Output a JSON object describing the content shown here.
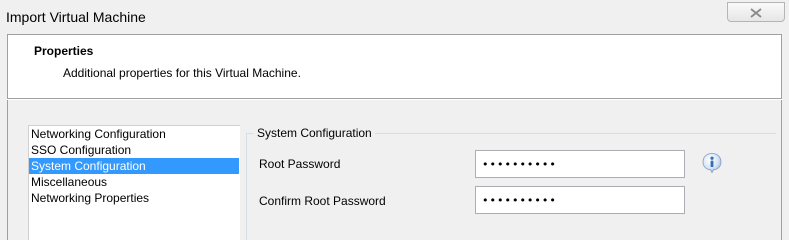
{
  "window": {
    "title": "Import Virtual Machine"
  },
  "header": {
    "title": "Properties",
    "subtitle": "Additional properties for this Virtual Machine."
  },
  "sidebar": {
    "items": [
      {
        "label": "Networking Configuration",
        "selected": false
      },
      {
        "label": "SSO Configuration",
        "selected": false
      },
      {
        "label": "System Configuration",
        "selected": true
      },
      {
        "label": "Miscellaneous",
        "selected": false
      },
      {
        "label": "Networking Properties",
        "selected": false
      }
    ]
  },
  "system_configuration": {
    "group_title": "System Configuration",
    "root_password_label": "Root Password",
    "root_password_value": "••••••••••",
    "confirm_root_password_label": "Confirm Root Password",
    "confirm_root_password_value": "••••••••••",
    "info_icon": "info-icon"
  },
  "colors": {
    "selection": "#3399ff",
    "info_icon": "#2f6fb5"
  }
}
